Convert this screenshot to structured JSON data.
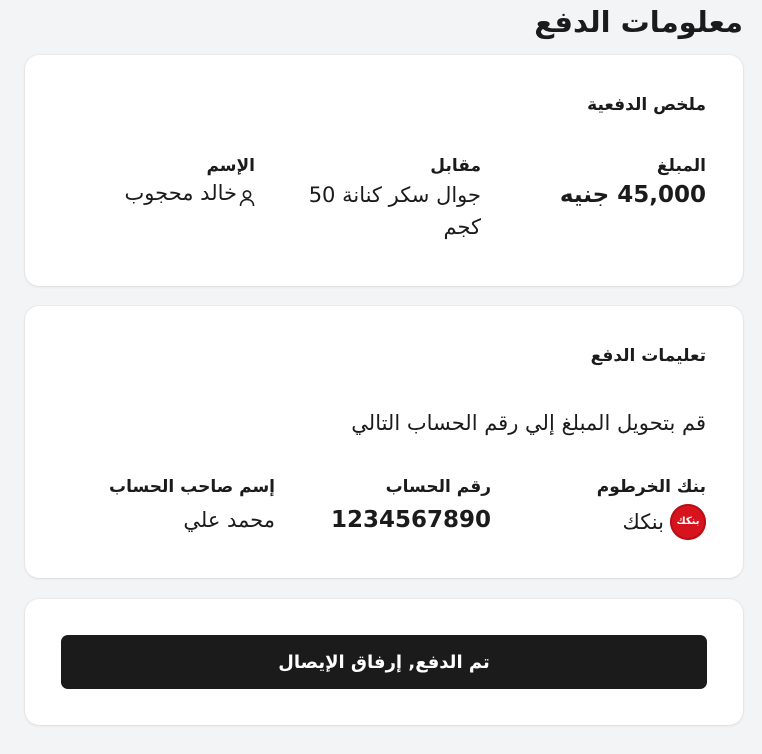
{
  "page": {
    "title": "معلومات الدفع"
  },
  "summary": {
    "title": "ملخص الدفعية",
    "amount_label": "المبلغ",
    "amount_value": "45,000 جنيه",
    "for_label": "مقابل",
    "for_value": "جوال سكر كنانة 50 كجم",
    "name_label": "الإسم",
    "name_value": "خالد محجوب",
    "name_icon": "user-icon"
  },
  "instructions": {
    "title": "تعليمات الدفع",
    "text": "قم بتحويل المبلغ إلي رقم الحساب التالي",
    "bank_label": "بنك الخرطوم",
    "bank_value": "بنكك",
    "bank_logo_text": "بنكك",
    "bank_logo_color": "#d7141d",
    "account_number_label": "رقم الحساب",
    "account_number_value": "1234567890",
    "account_holder_label": "إسم صاحب الحساب",
    "account_holder_value": "محمد علي"
  },
  "action": {
    "confirm_label": "تم الدفع, إرفاق الإيصال"
  },
  "colors": {
    "background": "#f3f4f6",
    "card": "#ffffff",
    "text": "#1b1b1b",
    "button": "#1b1b1b",
    "button_text": "#ffffff"
  }
}
